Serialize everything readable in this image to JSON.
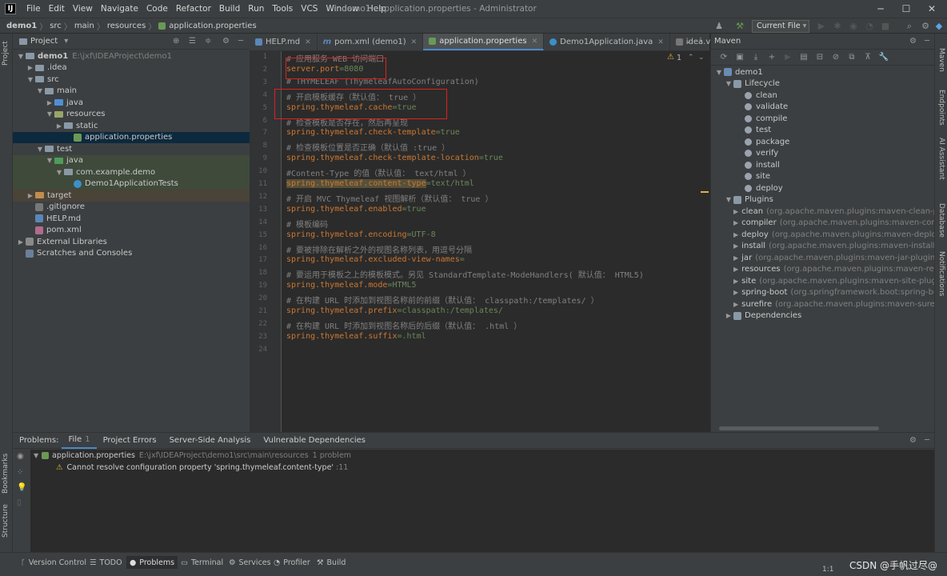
{
  "menubar": {
    "items": [
      "File",
      "Edit",
      "View",
      "Navigate",
      "Code",
      "Refactor",
      "Build",
      "Run",
      "Tools",
      "VCS",
      "Window",
      "Help"
    ],
    "title": "demo1 - application.properties - Administrator"
  },
  "breadcrumb": [
    "demo1",
    "src",
    "main",
    "resources",
    "application.properties"
  ],
  "toolbar": {
    "run_config": "Current File"
  },
  "left_stripe": {
    "project": "Project",
    "bookmarks": "Bookmarks",
    "structure": "Structure"
  },
  "project": {
    "title": "Project",
    "tree": [
      {
        "label": "demo1",
        "extra": "E:\\jxf\\IDEAProject\\demo1"
      },
      {
        "label": ".idea"
      },
      {
        "label": "src"
      },
      {
        "label": "main"
      },
      {
        "label": "java"
      },
      {
        "label": "resources"
      },
      {
        "label": "static"
      },
      {
        "label": "application.properties"
      },
      {
        "label": "test"
      },
      {
        "label": "java"
      },
      {
        "label": "com.example.demo"
      },
      {
        "label": "Demo1ApplicationTests"
      },
      {
        "label": "target"
      },
      {
        "label": ".gitignore"
      },
      {
        "label": "HELP.md"
      },
      {
        "label": "pom.xml"
      },
      {
        "label": "External Libraries"
      },
      {
        "label": "Scratches and Consoles"
      }
    ]
  },
  "tabs": [
    "HELP.md",
    "pom.xml (demo1)",
    "application.properties",
    "Demo1Application.java",
    "idea.vmoptions"
  ],
  "editor": {
    "warning_count": "1",
    "lines": [
      {
        "n": "1",
        "k": "# 应用服务 WEB 访问端口",
        "v": ""
      },
      {
        "n": "2",
        "k": "server.port",
        "v": "=8080"
      },
      {
        "n": "3",
        "k": "# THYMELEAF (ThymeleafAutoConfiguration)",
        "v": ""
      },
      {
        "n": "4",
        "k": "# 开启模板缓存（默认值： true ）",
        "v": ""
      },
      {
        "n": "5",
        "k": "spring.thymeleaf.cache",
        "v": "=true"
      },
      {
        "n": "6",
        "k": "# 检查模板是否存在，然后再呈现",
        "v": ""
      },
      {
        "n": "7",
        "k": "spring.thymeleaf.check-template",
        "v": "=true"
      },
      {
        "n": "8",
        "k": "# 检查模板位置是否正确（默认值 :true ）",
        "v": ""
      },
      {
        "n": "9",
        "k": "spring.thymeleaf.check-template-location",
        "v": "=true"
      },
      {
        "n": "10",
        "k": "#Content-Type 的值（默认值： text/html ）",
        "v": ""
      },
      {
        "n": "11",
        "k": "spring.thymeleaf.content-type",
        "v": "=text/html"
      },
      {
        "n": "12",
        "k": "# 开启 MVC Thymeleaf 视图解析（默认值： true ）",
        "v": ""
      },
      {
        "n": "13",
        "k": "spring.thymeleaf.enabled",
        "v": "=true"
      },
      {
        "n": "14",
        "k": "# 模板编码",
        "v": ""
      },
      {
        "n": "15",
        "k": "spring.thymeleaf.encoding",
        "v": "=UTF-8"
      },
      {
        "n": "16",
        "k": "# 要被排除在解析之外的视图名称列表，用逗号分隔",
        "v": ""
      },
      {
        "n": "17",
        "k": "spring.thymeleaf.excluded-view-names",
        "v": "="
      },
      {
        "n": "18",
        "k": "# 要运用于模板之上的模板模式。另见 StandardTemplate-ModeHandlers( 默认值： HTML5)",
        "v": ""
      },
      {
        "n": "19",
        "k": "spring.thymeleaf.mode",
        "v": "=HTML5"
      },
      {
        "n": "20",
        "k": "# 在构建 URL 时添加到视图名称前的前缀（默认值： classpath:/templates/ ）",
        "v": ""
      },
      {
        "n": "21",
        "k": "spring.thymeleaf.prefix",
        "v": "=classpath:/templates/"
      },
      {
        "n": "22",
        "k": "# 在构建 URL 时添加到视图名称后的后缀（默认值： .html ）",
        "v": ""
      },
      {
        "n": "23",
        "k": "spring.thymeleaf.suffix",
        "v": "=.html"
      },
      {
        "n": "24",
        "k": "",
        "v": ""
      }
    ]
  },
  "maven": {
    "title": "Maven",
    "rows": [
      {
        "label": "demo1",
        "dim": ""
      },
      {
        "label": "Lifecycle",
        "dim": ""
      },
      {
        "label": "clean",
        "dim": ""
      },
      {
        "label": "validate",
        "dim": ""
      },
      {
        "label": "compile",
        "dim": ""
      },
      {
        "label": "test",
        "dim": ""
      },
      {
        "label": "package",
        "dim": ""
      },
      {
        "label": "verify",
        "dim": ""
      },
      {
        "label": "install",
        "dim": ""
      },
      {
        "label": "site",
        "dim": ""
      },
      {
        "label": "deploy",
        "dim": ""
      },
      {
        "label": "Plugins",
        "dim": ""
      },
      {
        "label": "clean",
        "dim": "(org.apache.maven.plugins:maven-clean-plugin"
      },
      {
        "label": "compiler",
        "dim": "(org.apache.maven.plugins:maven-compiler"
      },
      {
        "label": "deploy",
        "dim": "(org.apache.maven.plugins:maven-deploy-plu"
      },
      {
        "label": "install",
        "dim": "(org.apache.maven.plugins:maven-install-plugi"
      },
      {
        "label": "jar",
        "dim": "(org.apache.maven.plugins:maven-jar-plugin:3.3.0"
      },
      {
        "label": "resources",
        "dim": "(org.apache.maven.plugins:maven-resourc"
      },
      {
        "label": "site",
        "dim": "(org.apache.maven.plugins:maven-site-plugin:3.1"
      },
      {
        "label": "spring-boot",
        "dim": "(org.springframework.boot:spring-boot"
      },
      {
        "label": "surefire",
        "dim": "(org.apache.maven.plugins:maven-surefire-p"
      },
      {
        "label": "Dependencies",
        "dim": ""
      }
    ]
  },
  "right_stripe": {
    "maven": "Maven",
    "endpoints": "Endpoints",
    "ai": "AI Assistant",
    "database": "Database",
    "notifications": "Notifications"
  },
  "problems": {
    "label": "Problems:",
    "tabs": [
      "File",
      "Project Errors",
      "Server-Side Analysis",
      "Vulnerable Dependencies"
    ],
    "file_count": "1",
    "file": "application.properties",
    "file_path": "E:\\jxf\\IDEAProject\\demo1\\src\\main\\resources",
    "file_problems": "1 problem",
    "message": "Cannot resolve configuration property 'spring.thymeleaf.content-type'",
    "message_loc": ":11"
  },
  "bottom": {
    "tabs": [
      "Version Control",
      "TODO",
      "Problems",
      "Terminal",
      "Services",
      "Profiler",
      "Build"
    ],
    "status": "1:1",
    "watermark": "CSDN @手帆过尽@"
  },
  "colors": {
    "key": "#cc7832",
    "value": "#6a8759",
    "comment": "#808080",
    "highlight": "#57503a",
    "accent": "#4a88c7",
    "annotation": "#e02020"
  }
}
